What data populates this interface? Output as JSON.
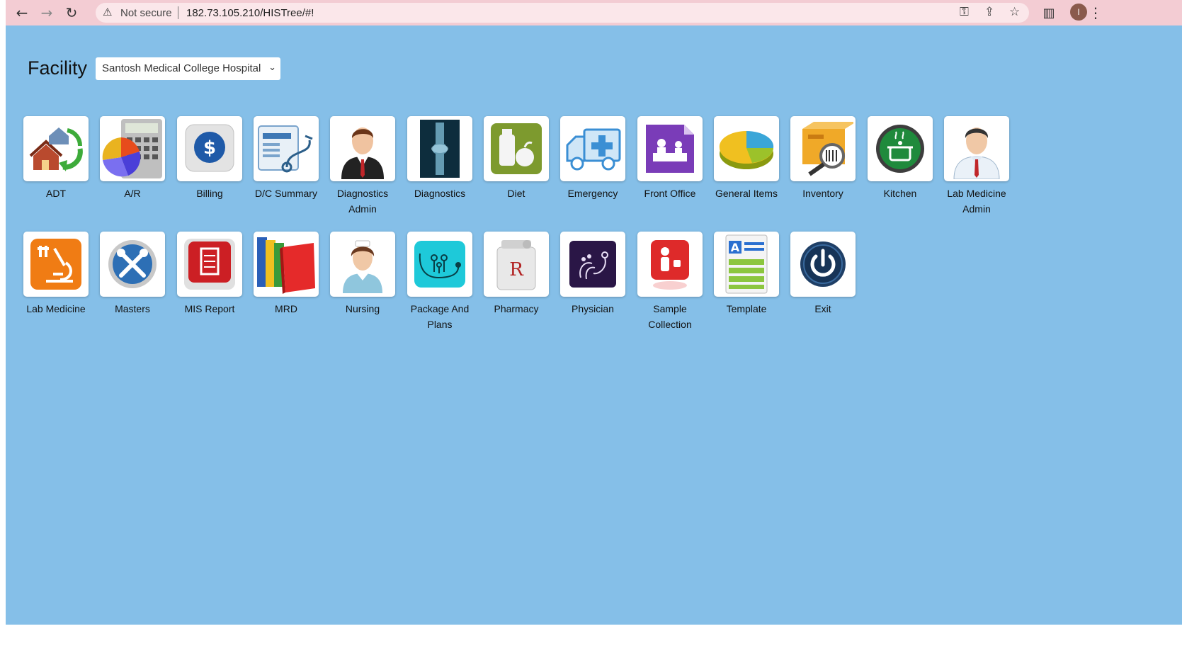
{
  "browser": {
    "back_icon": "←",
    "forward_icon": "→",
    "reload_icon": "↻",
    "warning_icon": "⚠",
    "security_text": "Not secure",
    "url": "182.73.105.210/HISTree/#!",
    "key_icon": "⚿",
    "share_icon": "⇪",
    "star_icon": "☆",
    "sidepanel_icon": "▥",
    "profile_initial": "I",
    "menu_icon": "⋮"
  },
  "facility": {
    "label": "Facility",
    "selected": "Santosh Medical College Hospital",
    "chevron": "⌄"
  },
  "modules": [
    {
      "line1": "ADT",
      "line2": "",
      "icon": "house-arrows-icon"
    },
    {
      "line1": "A/R",
      "line2": "",
      "icon": "calculator-chart-icon"
    },
    {
      "line1": "Billing",
      "line2": "",
      "icon": "dollar-icon"
    },
    {
      "line1": "D/C Summary",
      "line2": "",
      "icon": "stethoscope-report-icon"
    },
    {
      "line1": "Diagnostics",
      "line2": "Admin",
      "icon": "doctor-suit-icon"
    },
    {
      "line1": "Diagnostics",
      "line2": "",
      "icon": "xray-icon"
    },
    {
      "line1": "Diet",
      "line2": "",
      "icon": "diet-icon"
    },
    {
      "line1": "Emergency",
      "line2": "",
      "icon": "ambulance-icon"
    },
    {
      "line1": "Front Office",
      "line2": "",
      "icon": "front-desk-icon"
    },
    {
      "line1": "General Items",
      "line2": "",
      "icon": "pie-chart-icon"
    },
    {
      "line1": "Inventory",
      "line2": "",
      "icon": "box-magnifier-icon"
    },
    {
      "line1": "Kitchen",
      "line2": "",
      "icon": "cooking-pot-icon"
    },
    {
      "line1": "Lab Medicine",
      "line2": "Admin",
      "icon": "doctor-icon"
    },
    {
      "line1": "Lab Medicine",
      "line2": "",
      "icon": "microscope-icon"
    },
    {
      "line1": "Masters",
      "line2": "",
      "icon": "tools-icon"
    },
    {
      "line1": "MIS Report",
      "line2": "",
      "icon": "report-icon"
    },
    {
      "line1": "MRD",
      "line2": "",
      "icon": "folders-icon"
    },
    {
      "line1": "Nursing",
      "line2": "",
      "icon": "nurse-icon"
    },
    {
      "line1": "Package And",
      "line2": "Plans",
      "icon": "family-stethoscope-icon"
    },
    {
      "line1": "Pharmacy",
      "line2": "",
      "icon": "rx-bottle-icon"
    },
    {
      "line1": "Physician",
      "line2": "",
      "icon": "physician-stethoscope-icon"
    },
    {
      "line1": "Sample",
      "line2": "Collection",
      "icon": "sample-collection-icon"
    },
    {
      "line1": "Template",
      "line2": "",
      "icon": "template-icon"
    },
    {
      "line1": "Exit",
      "line2": "",
      "icon": "power-icon"
    }
  ]
}
